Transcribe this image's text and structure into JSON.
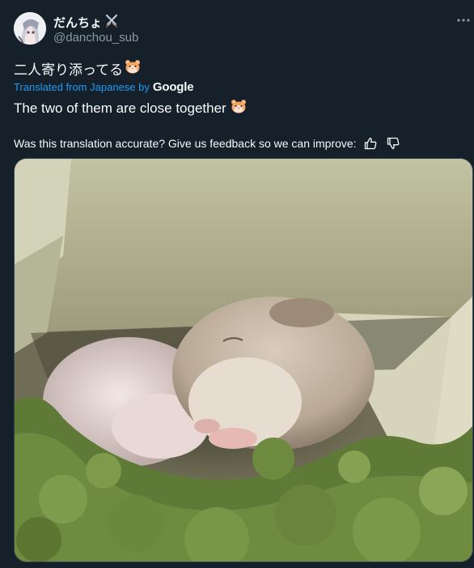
{
  "author": {
    "display_name": "だんちょ",
    "badge_icon": "crossed-swords-icon",
    "handle": "@danchou_sub"
  },
  "more_icon": "more-options-icon",
  "tweet": {
    "original_text": "二人寄り添ってる",
    "emoji_icon": "hamster-face-icon",
    "translated_label": "Translated from Japanese by",
    "translator_brand": "Google",
    "translated_text": "The two of them are close together"
  },
  "feedback": {
    "prompt": "Was this translation accurate? Give us feedback so we can improve:",
    "thumbs_up_icon": "thumbs-up-icon",
    "thumbs_down_icon": "thumbs-down-icon"
  },
  "media": {
    "alt_icon": "photo-two-hamsters-sleeping"
  },
  "colors": {
    "background": "#15202b",
    "text": "#f7f9f9",
    "secondary": "#8b98a5",
    "link": "#1d9bf0"
  }
}
